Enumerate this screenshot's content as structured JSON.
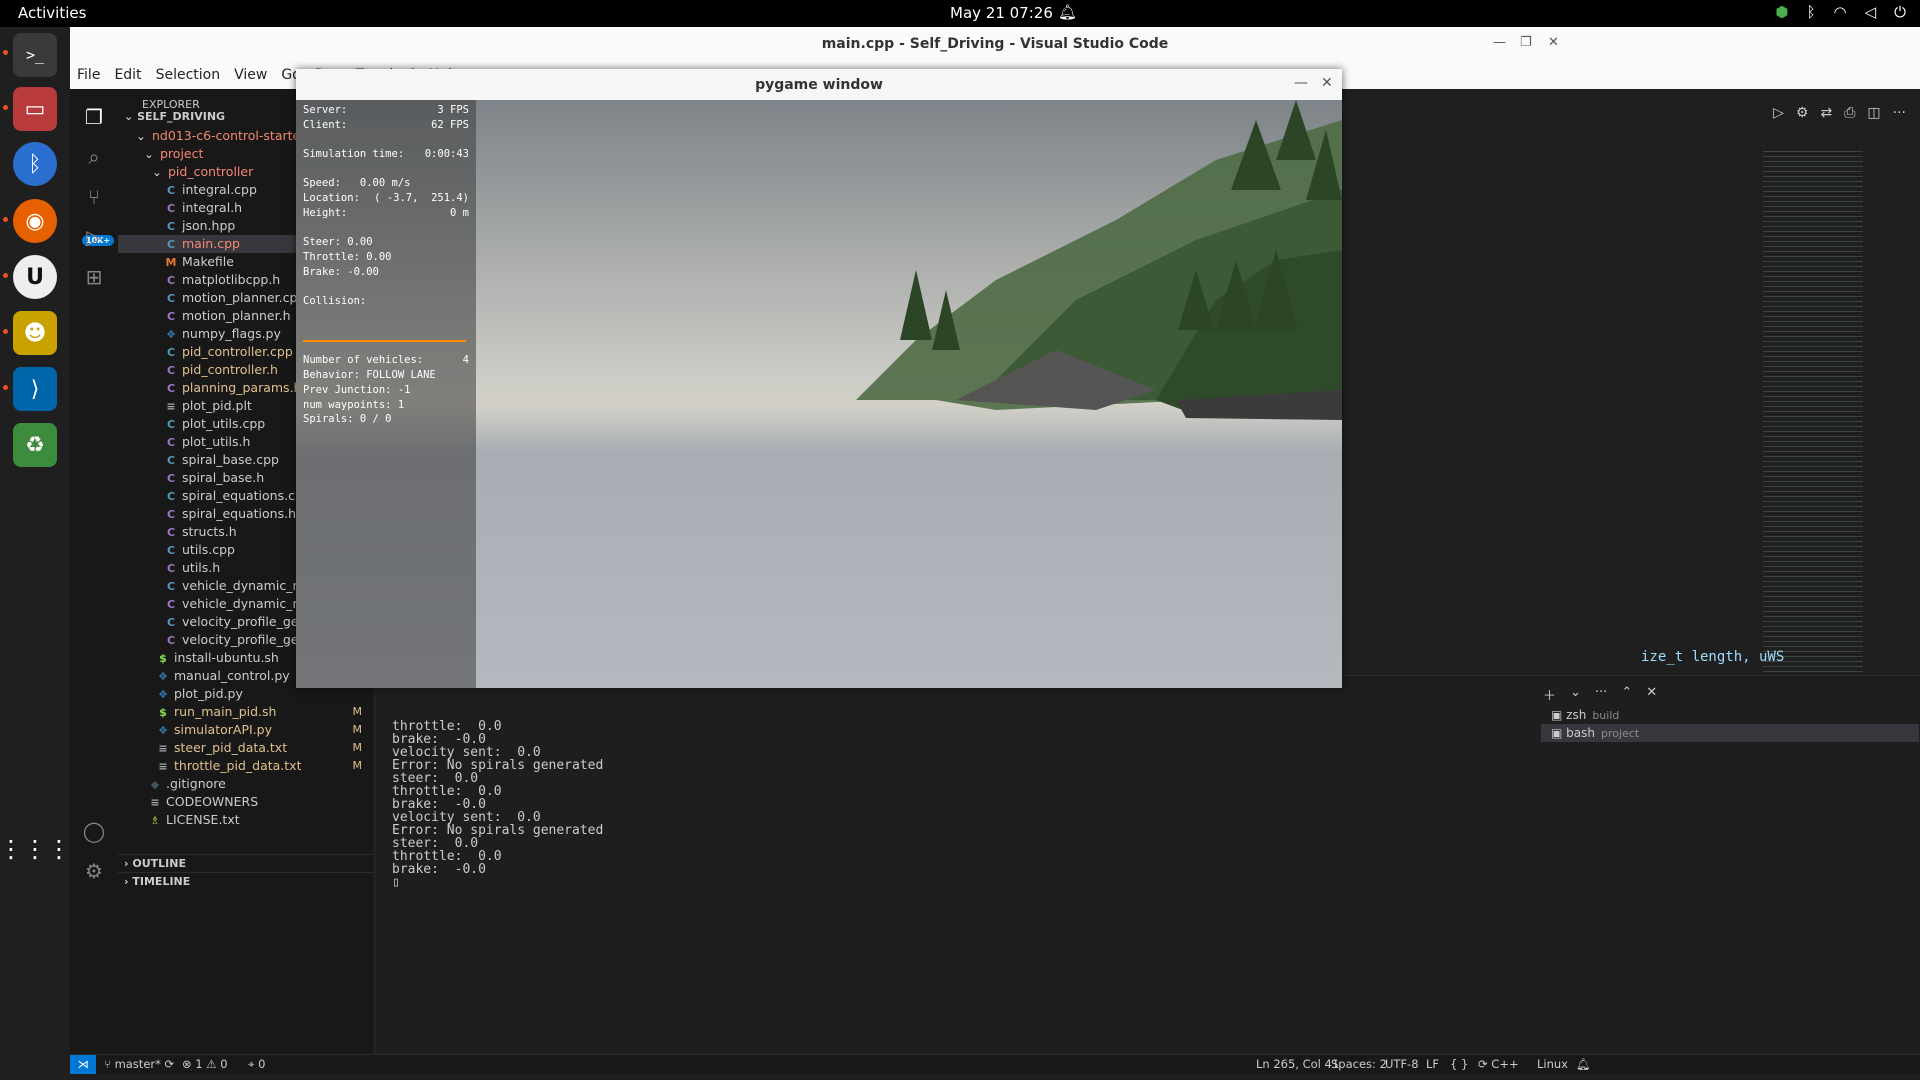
{
  "topbar": {
    "activities": "Activities",
    "clock": "May 21  07:26"
  },
  "window": {
    "title": "main.cpp - Self_Driving - Visual Studio Code"
  },
  "menu": [
    "File",
    "Edit",
    "Selection",
    "View",
    "Go",
    "Run",
    "Terminal",
    "Help"
  ],
  "activity": {
    "badge": "10K+"
  },
  "explorer": {
    "header": "EXPLORER",
    "root": "SELF_DRIVING",
    "tree": [
      {
        "label": "nd013-c6-control-starter",
        "kind": "folder",
        "depth": 1,
        "status": "●",
        "color": "red"
      },
      {
        "label": "project",
        "kind": "folder",
        "depth": 2,
        "status": "●",
        "color": "red"
      },
      {
        "label": "pid_controller",
        "kind": "folder",
        "depth": 3,
        "status": "●",
        "color": "red"
      },
      {
        "label": "integral.cpp",
        "kind": "cpp",
        "depth": 4,
        "status": ""
      },
      {
        "label": "integral.h",
        "kind": "h",
        "depth": 4,
        "status": ""
      },
      {
        "label": "json.hpp",
        "kind": "cpp",
        "depth": 4,
        "status": ""
      },
      {
        "label": "main.cpp",
        "kind": "cpp",
        "depth": 4,
        "status": "1, M",
        "color": "red",
        "selected": true
      },
      {
        "label": "Makefile",
        "kind": "make",
        "depth": 4,
        "status": ""
      },
      {
        "label": "matplotlibcpp.h",
        "kind": "h",
        "depth": 4,
        "status": ""
      },
      {
        "label": "motion_planner.cpp",
        "kind": "cpp",
        "depth": 4,
        "status": ""
      },
      {
        "label": "motion_planner.h",
        "kind": "h",
        "depth": 4,
        "status": ""
      },
      {
        "label": "numpy_flags.py",
        "kind": "py",
        "depth": 4,
        "status": ""
      },
      {
        "label": "pid_controller.cpp",
        "kind": "cpp",
        "depth": 4,
        "status": "M",
        "color": "mod"
      },
      {
        "label": "pid_controller.h",
        "kind": "h",
        "depth": 4,
        "status": "M",
        "color": "mod"
      },
      {
        "label": "planning_params.h",
        "kind": "h",
        "depth": 4,
        "status": "M",
        "color": "mod"
      },
      {
        "label": "plot_pid.plt",
        "kind": "txt",
        "depth": 4,
        "status": ""
      },
      {
        "label": "plot_utils.cpp",
        "kind": "cpp",
        "depth": 4,
        "status": ""
      },
      {
        "label": "plot_utils.h",
        "kind": "h",
        "depth": 4,
        "status": ""
      },
      {
        "label": "spiral_base.cpp",
        "kind": "cpp",
        "depth": 4,
        "status": ""
      },
      {
        "label": "spiral_base.h",
        "kind": "h",
        "depth": 4,
        "status": ""
      },
      {
        "label": "spiral_equations.cpp",
        "kind": "cpp",
        "depth": 4,
        "status": ""
      },
      {
        "label": "spiral_equations.h",
        "kind": "h",
        "depth": 4,
        "status": ""
      },
      {
        "label": "structs.h",
        "kind": "h",
        "depth": 4,
        "status": ""
      },
      {
        "label": "utils.cpp",
        "kind": "cpp",
        "depth": 4,
        "status": ""
      },
      {
        "label": "utils.h",
        "kind": "h",
        "depth": 4,
        "status": ""
      },
      {
        "label": "vehicle_dynamic_model.cpp",
        "kind": "cpp",
        "depth": 4,
        "status": ""
      },
      {
        "label": "vehicle_dynamic_model.h",
        "kind": "h",
        "depth": 4,
        "status": ""
      },
      {
        "label": "velocity_profile_generator.cpp",
        "kind": "cpp",
        "depth": 4,
        "status": ""
      },
      {
        "label": "velocity_profile_generator.h",
        "kind": "h",
        "depth": 4,
        "status": ""
      },
      {
        "label": "install-ubuntu.sh",
        "kind": "sh",
        "depth": 3,
        "status": ""
      },
      {
        "label": "manual_control.py",
        "kind": "py",
        "depth": 3,
        "status": ""
      },
      {
        "label": "plot_pid.py",
        "kind": "py",
        "depth": 3,
        "status": ""
      },
      {
        "label": "run_main_pid.sh",
        "kind": "sh",
        "depth": 3,
        "status": "M",
        "color": "mod"
      },
      {
        "label": "simulatorAPI.py",
        "kind": "py",
        "depth": 3,
        "status": "M",
        "color": "mod"
      },
      {
        "label": "steer_pid_data.txt",
        "kind": "txt",
        "depth": 3,
        "status": "M",
        "color": "mod"
      },
      {
        "label": "throttle_pid_data.txt",
        "kind": "txt",
        "depth": 3,
        "status": "M",
        "color": "mod"
      },
      {
        "label": ".gitignore",
        "kind": "git",
        "depth": 2,
        "status": ""
      },
      {
        "label": "CODEOWNERS",
        "kind": "txt",
        "depth": 2,
        "status": ""
      },
      {
        "label": "LICENSE.txt",
        "kind": "lic",
        "depth": 2,
        "status": ""
      }
    ],
    "outline": "OUTLINE",
    "timeline": "TIMELINE"
  },
  "editor": {
    "visible_code": "ize_t length, uWS"
  },
  "terminal": {
    "lines": [
      "throttle:  0.0",
      "brake:  -0.0",
      "velocity sent:  0.0",
      "Error: No spirals generated",
      "steer:  0.0",
      "throttle:  0.0",
      "brake:  -0.0",
      "velocity sent:  0.0",
      "Error: No spirals generated",
      "steer:  0.0",
      "throttle:  0.0",
      "brake:  -0.0",
      "▯"
    ],
    "sessions": [
      {
        "name": "zsh",
        "cwd": "build",
        "active": false
      },
      {
        "name": "bash",
        "cwd": "project",
        "active": true
      }
    ]
  },
  "status": {
    "branch": "master*",
    "errors": "1",
    "warnings": "0",
    "ports": "0",
    "position": "Ln 265, Col 41",
    "spaces": "Spaces: 2",
    "encoding": "UTF-8",
    "eol": "LF",
    "language": "C++",
    "os": "Linux"
  },
  "pygame": {
    "title": "pygame window",
    "hud": {
      "server_label": "Server:",
      "server_value": "3 FPS",
      "client_label": "Client:",
      "client_value": "62 FPS",
      "simtime_label": "Simulation time:",
      "simtime_value": "0:00:43",
      "speed": "Speed:   0.00 m/s",
      "location_label": "Location:",
      "location_value": "( -3.7,  251.4)",
      "height_label": "Height:",
      "height_value": "0 m",
      "steer": "Steer: 0.00",
      "throttle": "Throttle: 0.00",
      "brake": "Brake: -0.00",
      "collision": "Collision:",
      "vehicles_label": "Number of vehicles:",
      "vehicles_value": "4",
      "behavior": "Behavior: FOLLOW LANE",
      "junction": "Prev Junction: -1",
      "waypoints": "num waypoints: 1",
      "spirals": "Spirals: 0 / 0"
    }
  }
}
